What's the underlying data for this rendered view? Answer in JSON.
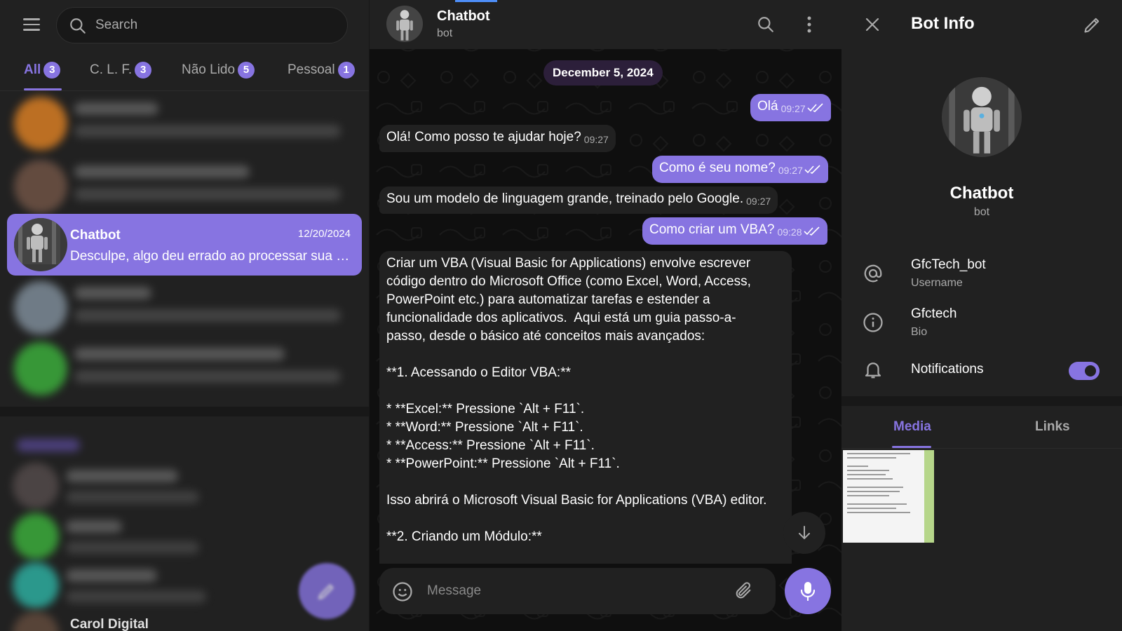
{
  "search": {
    "placeholder": "Search"
  },
  "folders": [
    {
      "label": "All",
      "count": "3"
    },
    {
      "label": "C. L. F.",
      "count": "3"
    },
    {
      "label": "Não Lido",
      "count": "5"
    },
    {
      "label": "Pessoal",
      "count": "1"
    }
  ],
  "chat_list": {
    "active": {
      "title": "Chatbot",
      "date": "12/20/2024",
      "preview": "Desculpe, algo deu errado ao processar sua solicitação."
    },
    "partial_contact": "Carol Digital"
  },
  "header": {
    "title": "Chatbot",
    "subtitle": "bot"
  },
  "date_pill": "December 5, 2024",
  "messages": [
    {
      "dir": "out",
      "text": "Olá",
      "time": "09:27"
    },
    {
      "dir": "in",
      "text": "Olá! Como posso te ajudar hoje?",
      "time": "09:27"
    },
    {
      "dir": "out",
      "text": "Como é seu nome?",
      "time": "09:27"
    },
    {
      "dir": "in",
      "text": "Sou um modelo de linguagem grande, treinado pelo Google.",
      "time": "09:27"
    },
    {
      "dir": "out",
      "text": "Como criar um VBA?",
      "time": "09:28"
    }
  ],
  "long_message": "Criar um VBA (Visual Basic for Applications) envolve escrever\ncódigo dentro do Microsoft Office (como Excel, Word, Access,\nPowerPoint etc.) para automatizar tarefas e estender a\nfuncionalidade dos aplicativos.  Aqui está um guia passo-a-\npasso, desde o básico até conceitos mais avançados:\n\n**1. Acessando o Editor VBA:**\n\n* **Excel:** Pressione `Alt + F11`.\n* **Word:** Pressione `Alt + F11`.\n* **Access:** Pressione `Alt + F11`.\n* **PowerPoint:** Pressione `Alt + F11`.\n\nIsso abrirá o Microsoft Visual Basic for Applications (VBA) editor.\n\n**2. Criando um Módulo:**",
  "composer": {
    "placeholder": "Message"
  },
  "bot_info": {
    "title": "Bot Info",
    "name": "Chatbot",
    "subtitle": "bot",
    "username": "GfcTech_bot",
    "username_label": "Username",
    "bio": "Gfctech",
    "bio_label": "Bio",
    "notifications_label": "Notifications",
    "notifications_on": true,
    "tabs": [
      "Media",
      "Links"
    ]
  },
  "colors": {
    "accent": "#8774e1",
    "panel": "#212121",
    "background": "#0f0f0f"
  },
  "icons": [
    "menu-icon",
    "search-icon",
    "more-icon",
    "close-icon",
    "edit-icon",
    "at-icon",
    "info-icon",
    "bell-icon",
    "emoji-icon",
    "attach-icon",
    "mic-icon",
    "arrow-down-icon"
  ]
}
